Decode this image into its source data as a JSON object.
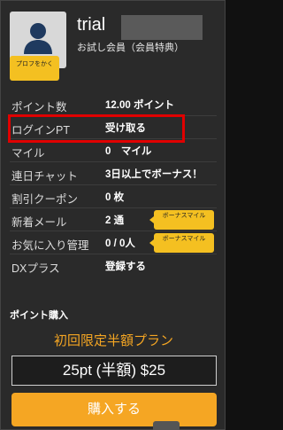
{
  "profile": {
    "username": "trial",
    "member_type": "お試し会員（会員特典）",
    "badge_label": "プロフをかく"
  },
  "rows": [
    {
      "label": "ポイント数",
      "value": "12.00 ポイント"
    },
    {
      "label": "ログインPT",
      "value": "受け取る"
    },
    {
      "label": "マイル",
      "value": "0　マイル"
    },
    {
      "label": "連日チャット",
      "value": "3日以上でボーナス！"
    },
    {
      "label": "割引クーポン",
      "value": "0 枚"
    },
    {
      "label": "新着メール",
      "value": "2 通"
    },
    {
      "label": "お気に入り管理",
      "value": "0 / 0人"
    },
    {
      "label": "DXプラス",
      "value": "登録する"
    }
  ],
  "bonus_badges": [
    {
      "label": "ボーナスマイル"
    },
    {
      "label": "ボーナスマイル"
    }
  ],
  "purchase": {
    "section_title": "ポイント購入",
    "campaign": "初回限定半額プラン",
    "plan": "25pt (半額) $25",
    "buy_label": "購入する"
  },
  "colors": {
    "accent": "#f5a623",
    "badge": "#f4c021",
    "highlight": "#e00000",
    "background": "#2a2a2a"
  }
}
